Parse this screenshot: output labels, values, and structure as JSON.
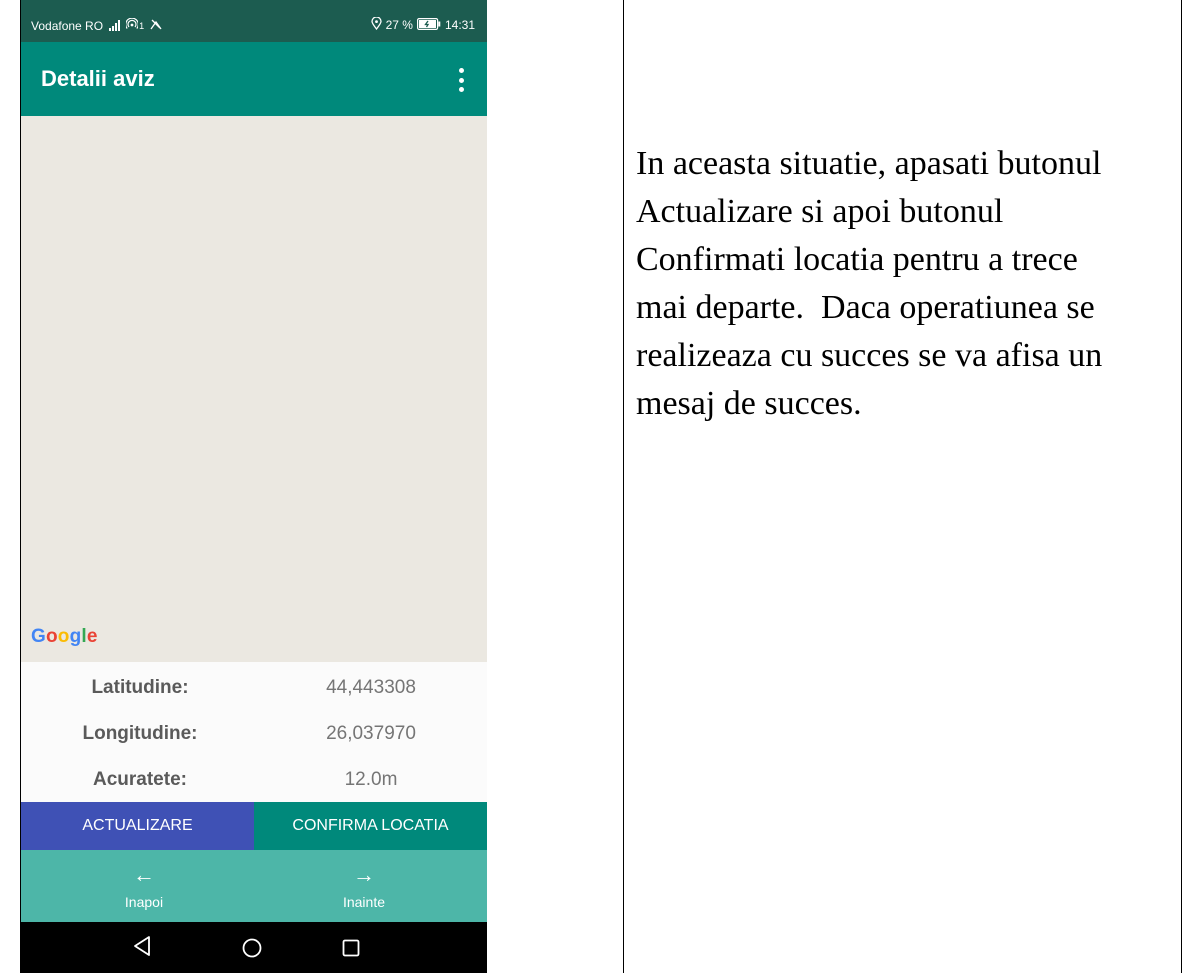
{
  "status_bar": {
    "carrier": "Vodafone RO",
    "network_sup": "1",
    "battery": "27 %",
    "time": "14:31"
  },
  "app_bar": {
    "title": "Detalii aviz"
  },
  "map": {
    "attribution": {
      "letters": [
        "G",
        "o",
        "o",
        "g",
        "l",
        "e"
      ],
      "colors": [
        "#4285f4",
        "#ea4335",
        "#fbbc05",
        "#4285f4",
        "#34a853",
        "#ea4335"
      ]
    }
  },
  "location_info": [
    {
      "label": "Latitudine:",
      "value": "44,443308"
    },
    {
      "label": "Longitudine:",
      "value": "26,037970"
    },
    {
      "label": "Acuratete:",
      "value": "12.0m"
    }
  ],
  "actions": {
    "update_label": "ACTUALIZARE",
    "confirm_label": "CONFIRMA LOCATIA"
  },
  "bottom_nav": {
    "back_label": "Inapoi",
    "next_label": "Inainte"
  },
  "instructions": {
    "lines": [
      "In aceasta situatie, apasati butonul",
      "Actualizare si apoi butonul",
      "Confirmati locatia pentru a trece",
      "mai departe.  Daca operatiunea se",
      "realizeaza cu succes se va afisa un",
      "mesaj de succes."
    ]
  },
  "colors": {
    "status_bar": "#1c5c50",
    "app_bar": "#00897b",
    "update_button": "#3f51b5",
    "confirm_button": "#00897b",
    "bottom_nav": "#4db6a8"
  }
}
